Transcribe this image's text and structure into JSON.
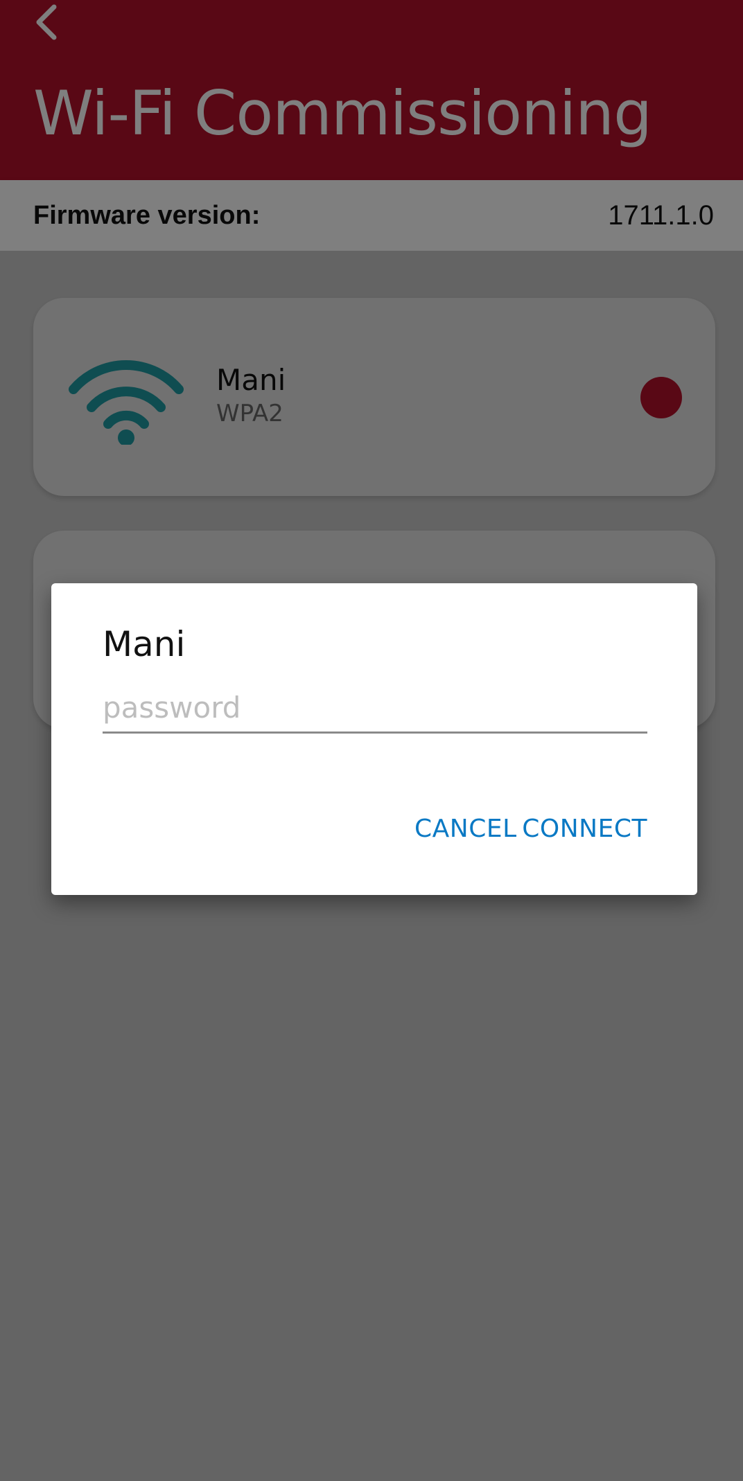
{
  "header": {
    "back_icon": "chevron-left-icon",
    "title": "Wi-Fi Commissioning",
    "bar_color": "#b3102a"
  },
  "firmware": {
    "label": "Firmware version:",
    "value": "1711.1.0"
  },
  "networks": [
    {
      "name": "Mani",
      "security": "WPA2",
      "icon": "wifi-icon",
      "status_color": "#b3102a"
    }
  ],
  "dialog": {
    "title": "Mani",
    "password_placeholder": "password",
    "password_value": "",
    "cancel_label": "CANCEL",
    "connect_label": "CONNECT",
    "button_color": "#0a79c4"
  }
}
